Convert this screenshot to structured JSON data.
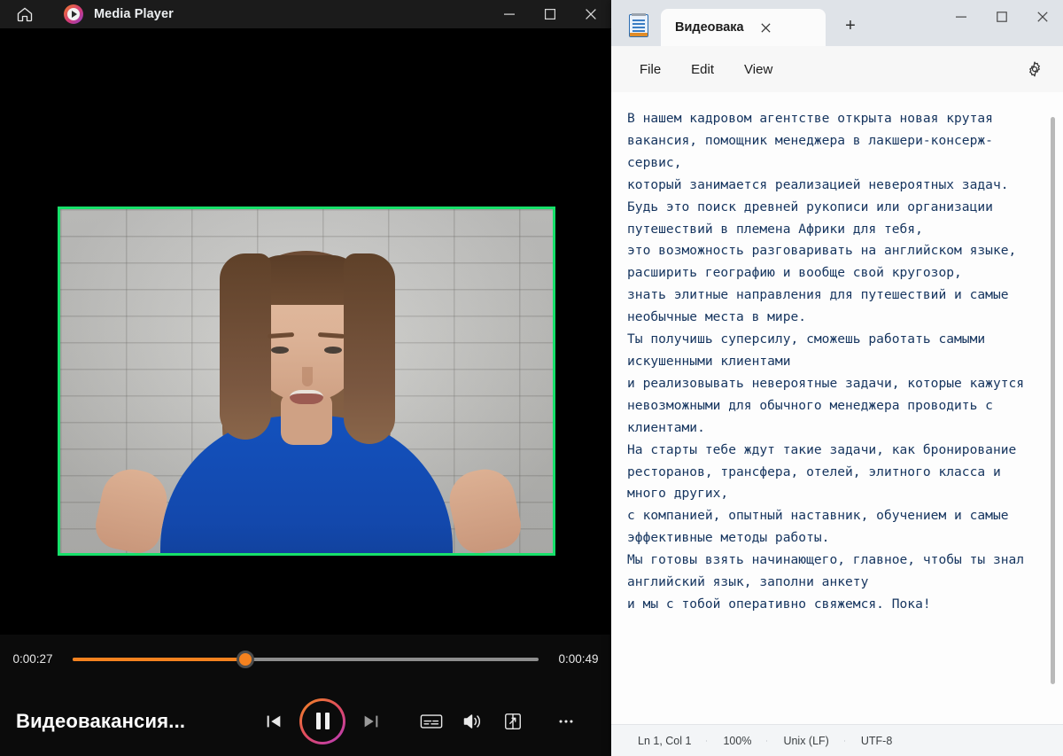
{
  "player": {
    "app_title": "Media Player",
    "home_icon": "home-icon",
    "logo_icon": "media-player-logo-icon",
    "window_controls": {
      "minimize": "–",
      "maximize": "□",
      "close": "✕"
    },
    "video": {
      "border_color": "#17e06a",
      "description": "woman speaking in front of a white brick wall"
    },
    "seek": {
      "elapsed": "0:00:27",
      "duration": "0:00:49",
      "progress_percent": 37,
      "fill_color": "#f5821f"
    },
    "now_playing": "Видеовакансия...",
    "controls": [
      {
        "name": "previous-button",
        "icon": "previous-track-icon"
      },
      {
        "name": "play-pause-button",
        "icon": "pause-icon",
        "state": "playing"
      },
      {
        "name": "next-button",
        "icon": "next-track-icon"
      },
      {
        "name": "captions-button",
        "icon": "closed-captions-icon"
      },
      {
        "name": "volume-button",
        "icon": "volume-icon"
      },
      {
        "name": "mini-player-button",
        "icon": "mini-player-icon"
      },
      {
        "name": "more-options-button",
        "icon": "more-horizontal-icon"
      }
    ]
  },
  "notepad": {
    "app_icon": "notepad-icon",
    "tab": {
      "label": "Видеовака",
      "close_label": "✕"
    },
    "new_tab_label": "+",
    "window_controls": {
      "minimize": "–",
      "maximize": "□",
      "close": "✕"
    },
    "menus": [
      {
        "label": "File"
      },
      {
        "label": "Edit"
      },
      {
        "label": "View"
      }
    ],
    "settings_icon": "gear-icon",
    "document_text": "В нашем кадровом агентстве открыта новая крутая вакансия, помощник менеджера в лакшери-консерж-сервис,\nкоторый занимается реализацией невероятных задач.\nБудь это поиск древней рукописи или организации путешествий в племена Африки для тебя,\nэто возможность разговаривать на английском языке, расширить географию и вообще свой кругозор,\nзнать элитные направления для путешествий и самые необычные места в мире.\nТы получишь суперсилу, сможешь работать самыми искушенными клиентами\nи реализовывать невероятные задачи, которые кажутся невозможными для обычного менеджера проводить с клиентами.\nНа старты тебе ждут такие задачи, как бронирование ресторанов, трансфера, отелей, элитного класса и много других,\nс компанией, опытный наставник, обучением и самые эффективные методы работы.\nМы готовы взять начинающего, главное, чтобы ты знал английский язык, заполни анкету\nи мы с тобой оперативно свяжемся. Пока!",
    "status_bar": {
      "cursor": "Ln 1, Col 1",
      "zoom": "100%",
      "line_ending": "Unix (LF)",
      "encoding": "UTF-8"
    }
  }
}
